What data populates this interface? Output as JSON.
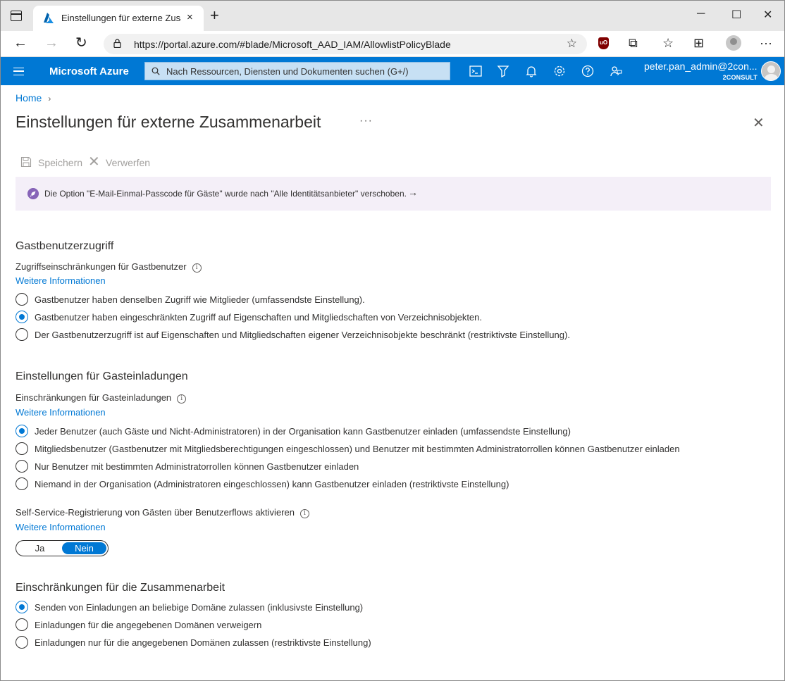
{
  "browser": {
    "tab_title": "Einstellungen für externe Zusammenarbeit",
    "tab_close": "×",
    "new_tab": "+",
    "url": "https://portal.azure.com/#blade/Microsoft_AAD_IAM/AllowlistPolicyBlade",
    "ublock_label": "uO"
  },
  "azure": {
    "brand": "Microsoft Azure",
    "search_placeholder": "Nach Ressourcen, Diensten und Dokumenten suchen (G+/)",
    "user_name": "peter.pan_admin@2con...",
    "user_tenant": "2CONSULT"
  },
  "page": {
    "breadcrumb_home": "Home",
    "breadcrumb_sep": "›",
    "title": "Einstellungen für externe Zusammenarbeit",
    "more": "···",
    "close": "✕",
    "save_label": "Speichern",
    "discard_label": "Verwerfen",
    "banner_text": "Die Option \"E-Mail-Einmal-Passcode für Gäste\" wurde nach \"Alle Identitätsanbieter\" verschoben.",
    "banner_arrow": "→",
    "info_glyph": "i",
    "more_info": "Weitere Informationen"
  },
  "guest_access": {
    "section_title": "Gastbenutzerzugriff",
    "field_label": "Zugriffseinschränkungen für Gastbenutzer",
    "options": [
      {
        "label": "Gastbenutzer haben denselben Zugriff wie Mitglieder (umfassendste Einstellung).",
        "checked": false
      },
      {
        "label": "Gastbenutzer haben eingeschränkten Zugriff auf Eigenschaften und Mitgliedschaften von Verzeichnisobjekten.",
        "checked": true
      },
      {
        "label": "Der Gastbenutzerzugriff ist auf Eigenschaften und Mitgliedschaften eigener Verzeichnisobjekte beschränkt (restriktivste Einstellung).",
        "checked": false
      }
    ]
  },
  "guest_invite": {
    "section_title": "Einstellungen für Gasteinladungen",
    "field_label": "Einschränkungen für Gasteinladungen",
    "options": [
      {
        "label": "Jeder Benutzer (auch Gäste und Nicht-Administratoren) in der Organisation kann Gastbenutzer einladen (umfassendste Einstellung)",
        "checked": true
      },
      {
        "label": "Mitgliedsbenutzer (Gastbenutzer mit Mitgliedsberechtigungen eingeschlossen) und Benutzer mit bestimmten Administratorrollen können Gastbenutzer einladen",
        "checked": false
      },
      {
        "label": "Nur Benutzer mit bestimmten Administratorrollen können Gastbenutzer einladen",
        "checked": false
      },
      {
        "label": "Niemand in der Organisation (Administratoren eingeschlossen) kann Gastbenutzer einladen (restriktivste Einstellung)",
        "checked": false
      }
    ],
    "self_service_label": "Self-Service-Registrierung von Gästen über Benutzerflows aktivieren",
    "toggle_yes": "Ja",
    "toggle_no": "Nein",
    "toggle_value": "Nein"
  },
  "collab_restrictions": {
    "section_title": "Einschränkungen für die Zusammenarbeit",
    "options": [
      {
        "label": "Senden von Einladungen an beliebige Domäne zulassen (inklusivste Einstellung)",
        "checked": true
      },
      {
        "label": "Einladungen für die angegebenen Domänen verweigern",
        "checked": false
      },
      {
        "label": "Einladungen nur für die angegebenen Domänen zulassen (restriktivste Einstellung)",
        "checked": false
      }
    ]
  },
  "colors": {
    "azure_blue": "#0078d4",
    "banner_bg": "#f4eff8",
    "banner_icon": "#8764b8"
  }
}
